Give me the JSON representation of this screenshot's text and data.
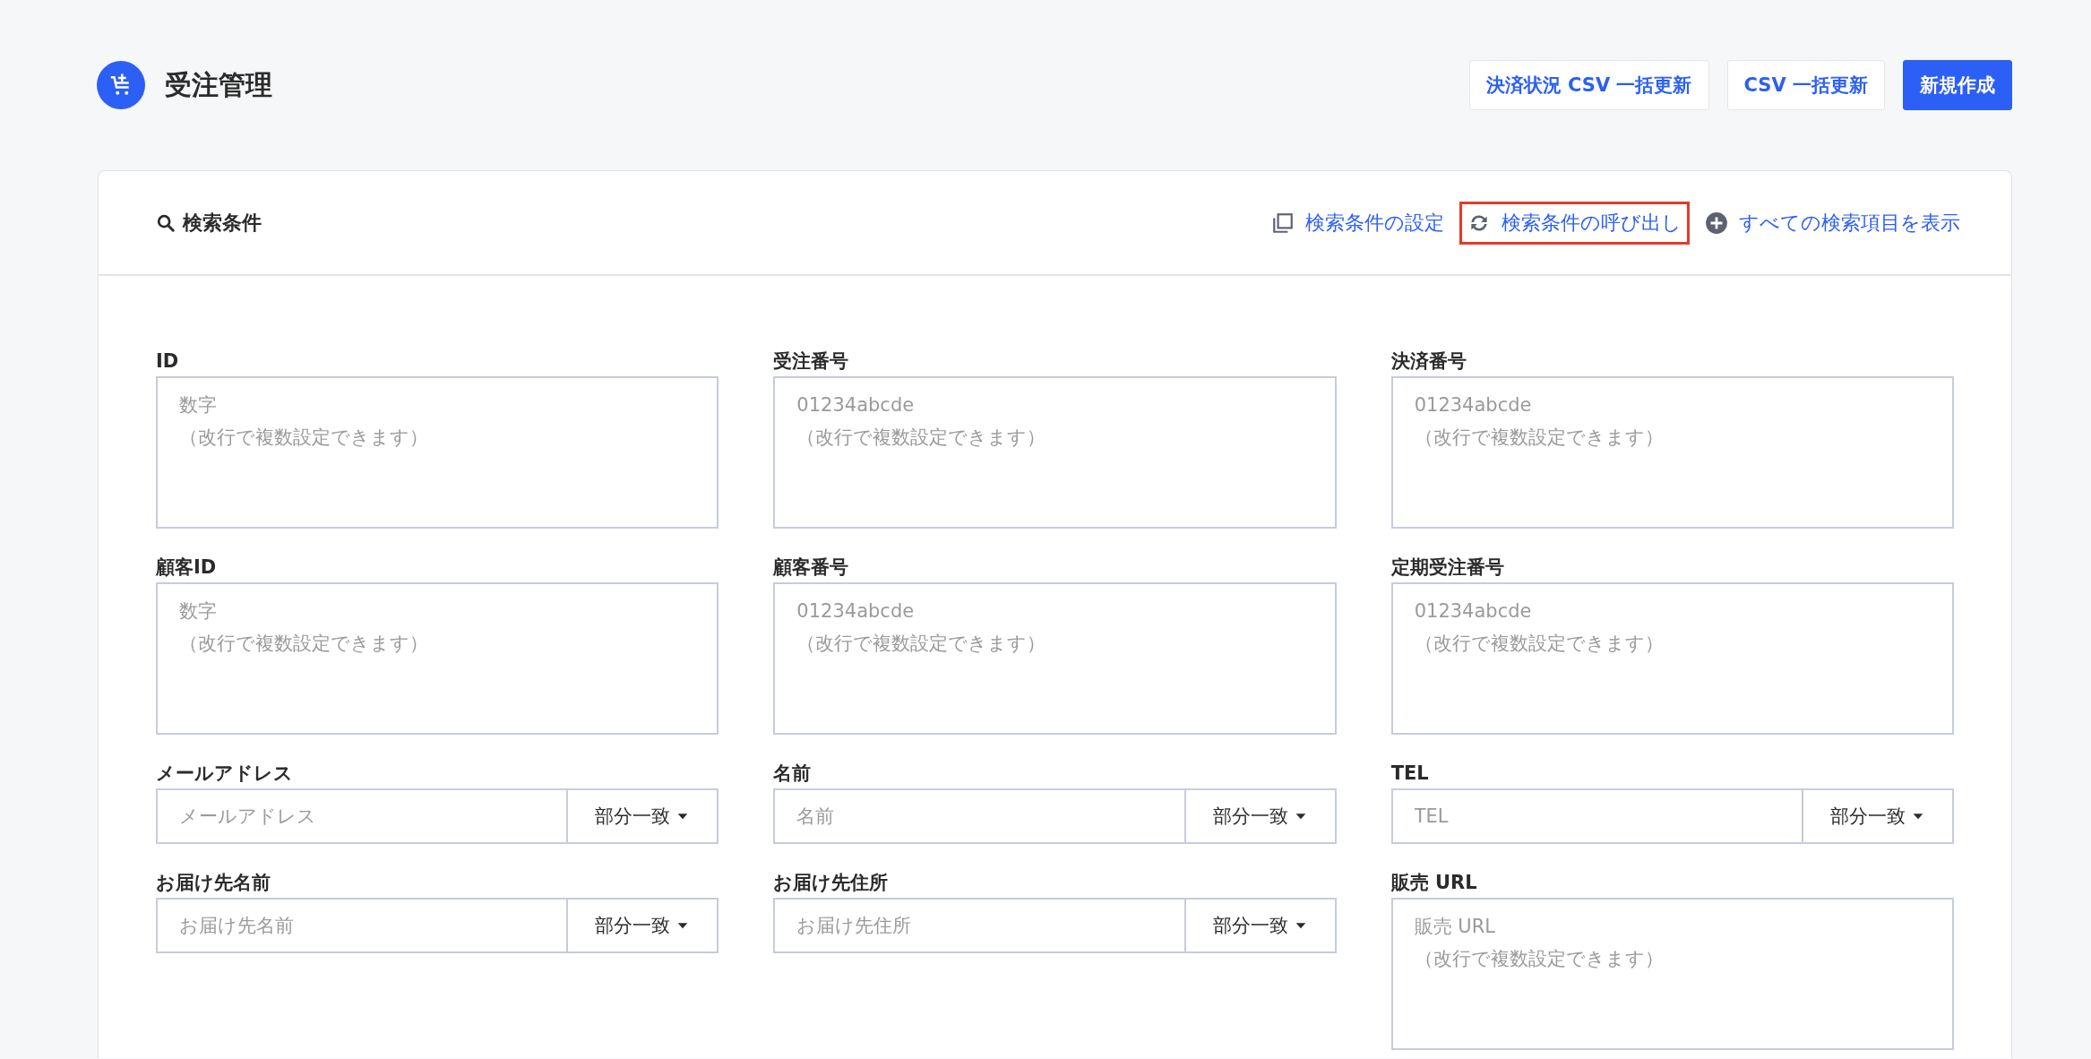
{
  "header": {
    "title": "受注管理",
    "buttons": [
      {
        "label": "決済状況 CSV 一括更新",
        "kind": "secondary"
      },
      {
        "label": "CSV 一括更新",
        "kind": "secondary"
      },
      {
        "label": "新規作成",
        "kind": "primary"
      }
    ]
  },
  "search_panel": {
    "title": "検索条件",
    "actions": [
      {
        "label": "検索条件の設定",
        "kind": "copy",
        "highlighted": false
      },
      {
        "label": "検索条件の呼び出し",
        "kind": "refresh",
        "highlighted": true
      },
      {
        "label": "すべての検索項目を表示",
        "kind": "plus",
        "highlighted": false
      }
    ],
    "columns": [
      [
        {
          "label": "ID",
          "kind": "textarea",
          "placeholder": "数字",
          "hint": "（改行で複数設定できます）"
        },
        {
          "label": "顧客ID",
          "kind": "textarea",
          "placeholder": "数字",
          "hint": "（改行で複数設定できます）"
        },
        {
          "label": "メールアドレス",
          "kind": "match",
          "placeholder": "メールアドレス",
          "match": "部分一致"
        },
        {
          "label": "お届け先名前",
          "kind": "match",
          "placeholder": "お届け先名前",
          "match": "部分一致"
        }
      ],
      [
        {
          "label": "受注番号",
          "kind": "textarea",
          "placeholder": "01234abcde",
          "hint": "（改行で複数設定できます）"
        },
        {
          "label": "顧客番号",
          "kind": "textarea",
          "placeholder": "01234abcde",
          "hint": "（改行で複数設定できます）"
        },
        {
          "label": "名前",
          "kind": "match",
          "placeholder": "名前",
          "match": "部分一致"
        },
        {
          "label": "お届け先住所",
          "kind": "match",
          "placeholder": "お届け先住所",
          "match": "部分一致"
        }
      ],
      [
        {
          "label": "決済番号",
          "kind": "textarea",
          "placeholder": "01234abcde",
          "hint": "（改行で複数設定できます）"
        },
        {
          "label": "定期受注番号",
          "kind": "textarea",
          "placeholder": "01234abcde",
          "hint": "（改行で複数設定できます）"
        },
        {
          "label": "TEL",
          "kind": "match",
          "placeholder": "TEL",
          "match": "部分一致"
        },
        {
          "label": "販売 URL",
          "kind": "textarea",
          "placeholder": "販売 URL",
          "hint": "（改行で複数設定できます）"
        }
      ]
    ]
  }
}
